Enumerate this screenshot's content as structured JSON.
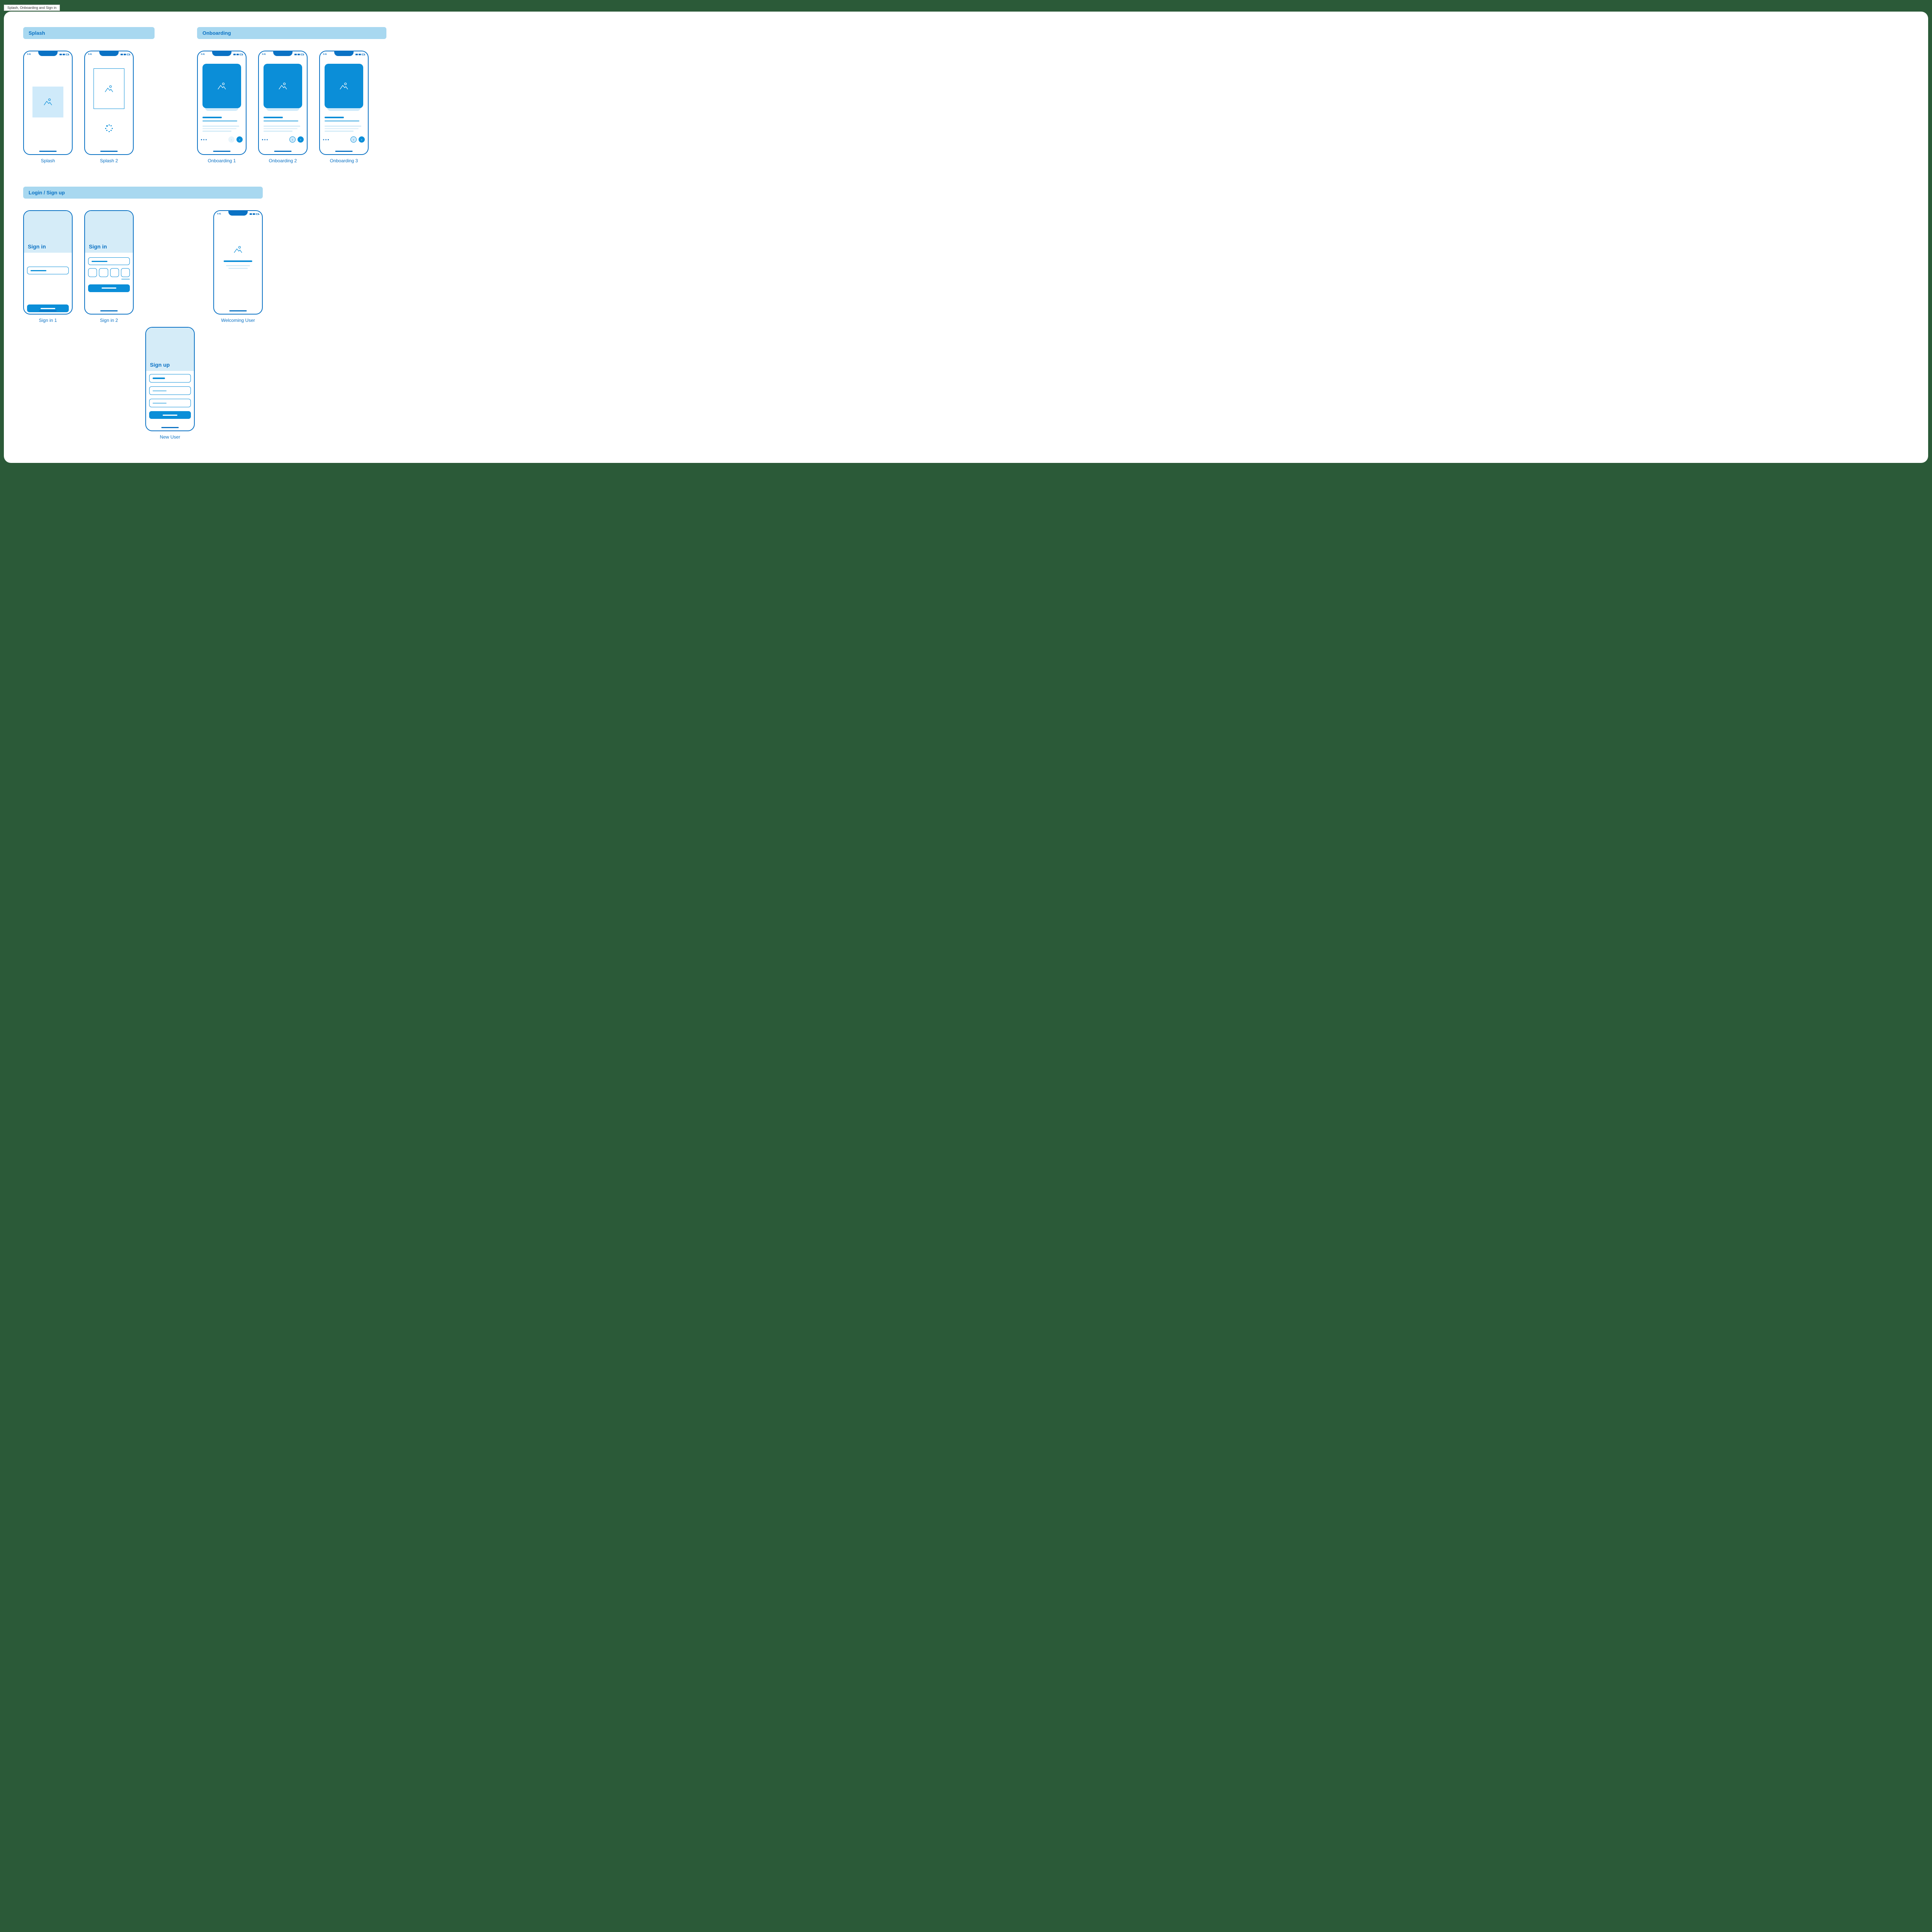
{
  "tab": {
    "label": "Splash, Onboarding and Sign in"
  },
  "sections": {
    "splash": {
      "title": "Splash"
    },
    "onboarding": {
      "title": "Onboarding"
    },
    "login": {
      "title": "Login / Sign up"
    }
  },
  "status": {
    "time": "9:41"
  },
  "screens": {
    "splash1": {
      "caption": "Splash"
    },
    "splash2": {
      "caption": "Splash 2"
    },
    "ob1": {
      "caption": "Onboarding 1"
    },
    "ob2": {
      "caption": "Onboarding 2"
    },
    "ob3": {
      "caption": "Onboarding 3"
    },
    "signin1": {
      "caption": "Sign in 1",
      "title": "Sign in"
    },
    "signin2": {
      "caption": "Sign in 2",
      "title": "Sign in"
    },
    "welcome": {
      "caption": "Welcoming User"
    },
    "newuser": {
      "caption": "New User",
      "title": "Sign up"
    }
  }
}
